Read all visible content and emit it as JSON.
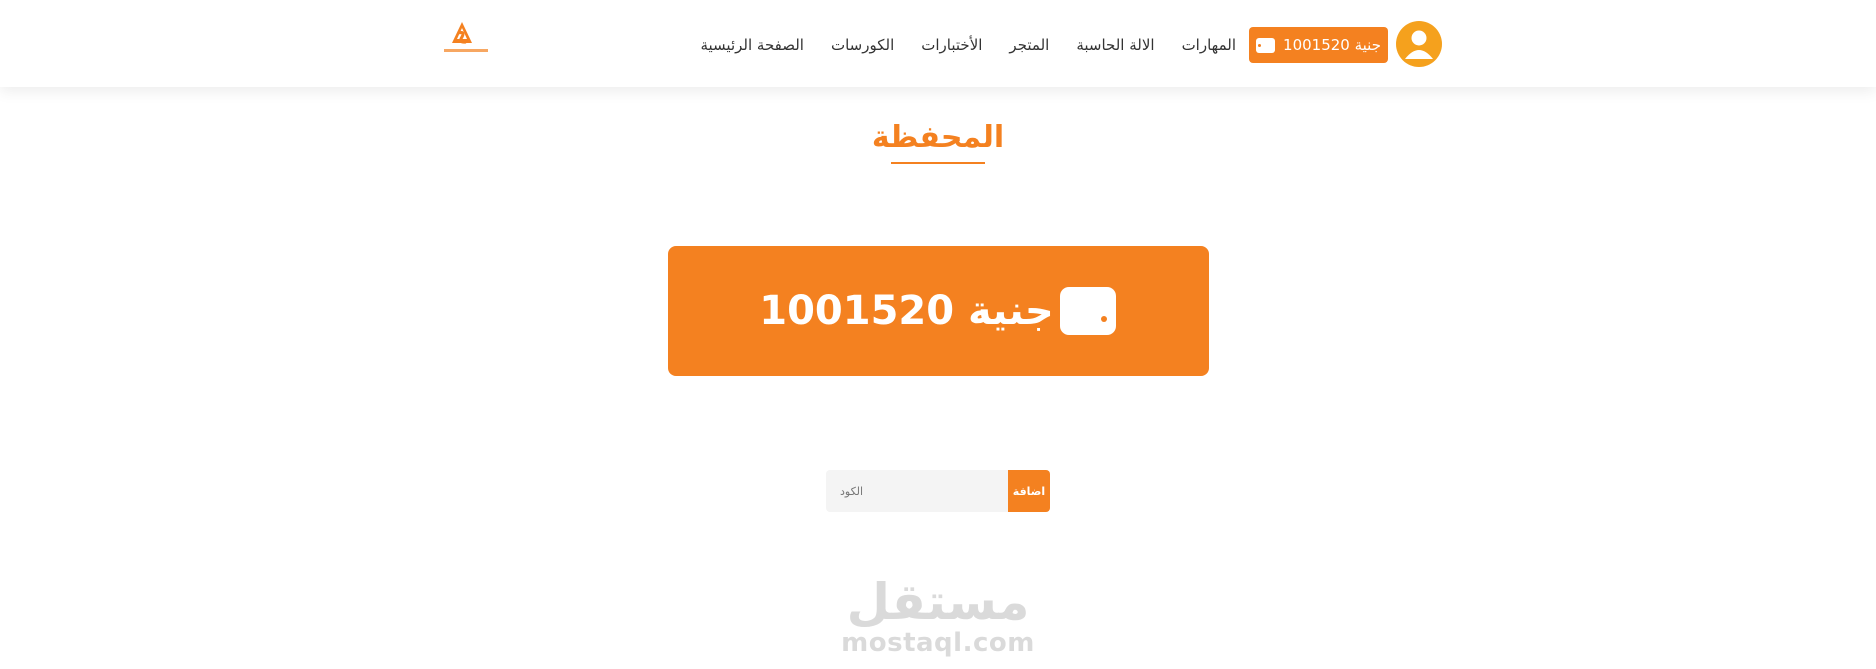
{
  "header": {
    "wallet_button_label": "جنية 1001520",
    "nav": [
      {
        "label": "الصفحة الرئيسية"
      },
      {
        "label": "الكورسات"
      },
      {
        "label": "الأختبارات"
      },
      {
        "label": "المتجر"
      },
      {
        "label": "الالة الحاسبة"
      },
      {
        "label": "المهارات"
      }
    ],
    "logo_alt": "logo"
  },
  "main": {
    "title": "المحفظة",
    "balance_label": "جنية 1001520",
    "code_form": {
      "placeholder": "الكود",
      "submit_label": "اضافة"
    }
  },
  "watermark": {
    "arabic": "مستقل",
    "latin": "mostaql.com"
  },
  "colors": {
    "accent": "#f48120",
    "avatar": "#f5a11d",
    "watermark": "#d6d6d6"
  },
  "icons": {
    "wallet": "wallet-icon",
    "user": "user-icon"
  }
}
